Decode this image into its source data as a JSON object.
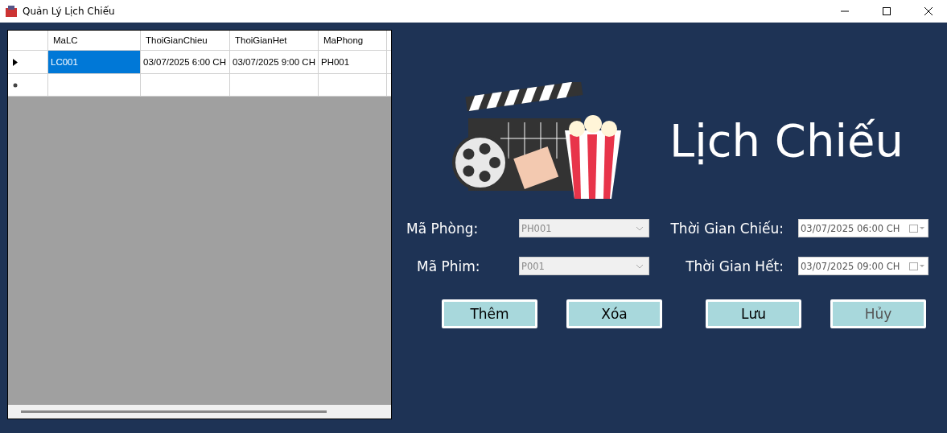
{
  "window": {
    "title": "Quản Lý Lịch Chiếu"
  },
  "table": {
    "columns": [
      "MaLC",
      "ThoiGianChieu",
      "ThoiGianHet",
      "MaPhong"
    ],
    "rows": [
      {
        "selected": true,
        "new_row": false,
        "cells": [
          "LC001",
          "03/07/2025 6:00 CH",
          "03/07/2025 9:00 CH",
          "PH001"
        ]
      },
      {
        "selected": false,
        "new_row": true,
        "cells": [
          "",
          "",
          "",
          ""
        ]
      }
    ]
  },
  "heading": "Lịch Chiếu",
  "form": [
    {
      "label": "Mã Phòng:",
      "kind": "combo",
      "value": "PH001",
      "disabled": true
    },
    {
      "label": "Thời Gian Chiếu:",
      "kind": "date",
      "value": "03/07/2025 06:00 CH",
      "disabled": false
    },
    {
      "label": "Mã Phim:",
      "kind": "combo",
      "value": "P001",
      "disabled": true
    },
    {
      "label": "Thời Gian Hết:",
      "kind": "date",
      "value": "03/07/2025 09:00 CH",
      "disabled": false
    }
  ],
  "buttons": [
    {
      "label": "Thêm",
      "disabled": false
    },
    {
      "label": "Xóa",
      "disabled": false
    },
    {
      "label": "Lưu",
      "disabled": false
    },
    {
      "label": "Hủy",
      "disabled": true
    }
  ]
}
